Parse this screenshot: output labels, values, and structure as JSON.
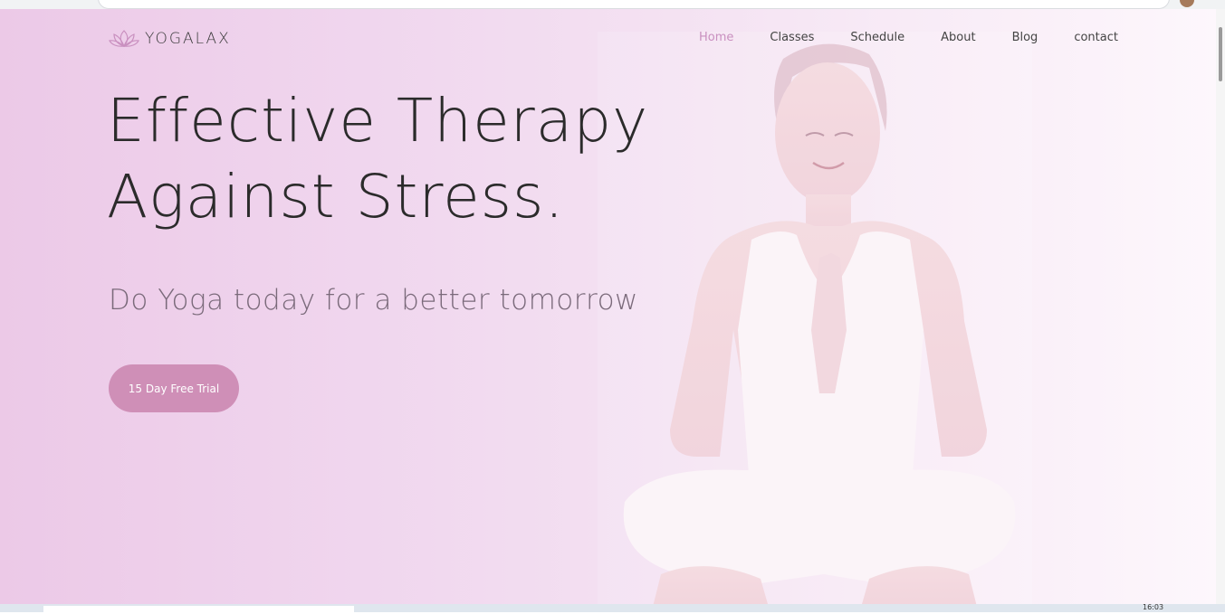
{
  "brand": {
    "name": "YOGALAX",
    "logo_icon": "lotus-icon"
  },
  "nav": {
    "items": [
      {
        "label": "Home",
        "active": true
      },
      {
        "label": "Classes"
      },
      {
        "label": "Schedule"
      },
      {
        "label": "About"
      },
      {
        "label": "Blog"
      },
      {
        "label": "contact"
      }
    ]
  },
  "hero": {
    "headline_line1": "Effective Therapy",
    "headline_line2": "Against Stress.",
    "subheadline": "Do Yoga today for a better tomorrow",
    "cta_label": "15 Day Free Trial"
  },
  "taskbar": {
    "clock": "16:03"
  },
  "colors": {
    "accent": "#cf8fb7",
    "nav_active": "#c98fbf",
    "hero_bg_left": "#ecc9e7",
    "hero_bg_right": "#fdf7fc"
  }
}
